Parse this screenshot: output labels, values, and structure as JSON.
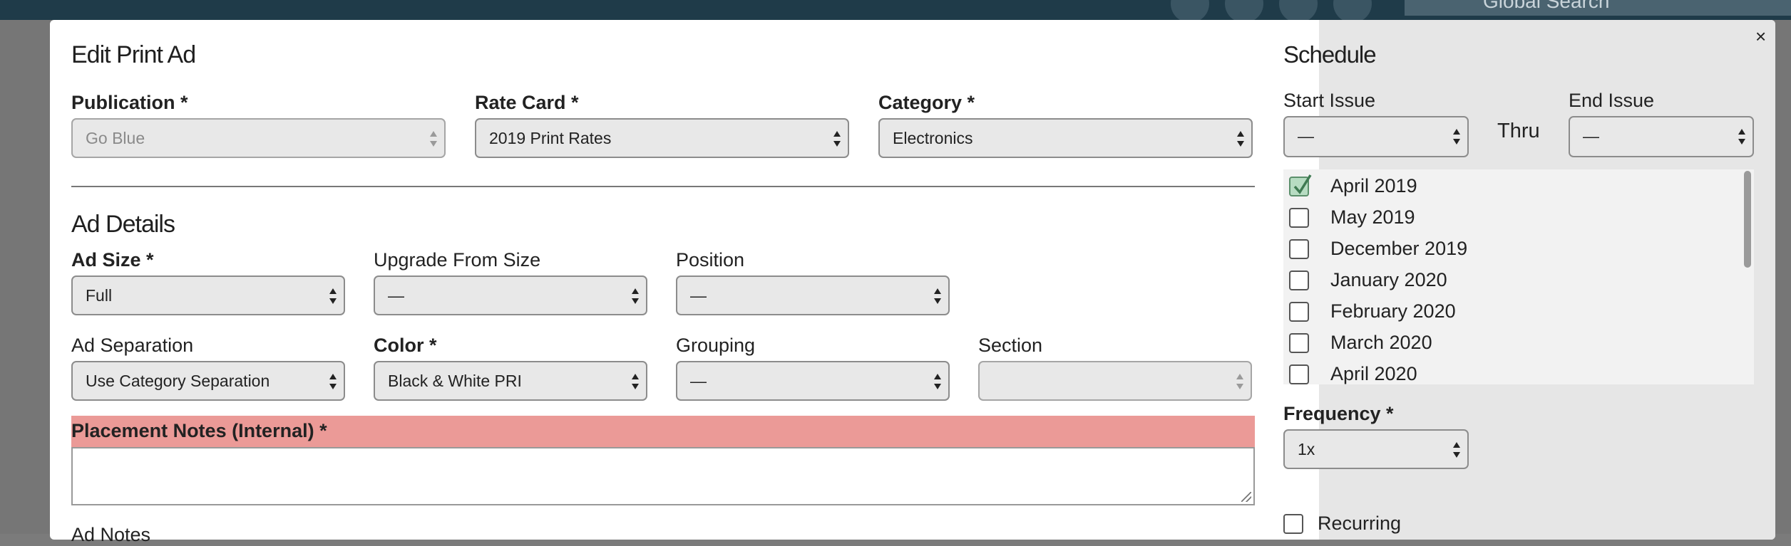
{
  "topbar": {
    "search_placeholder": "Global Search"
  },
  "modal": {
    "title": "Edit Print Ad",
    "close_label": "×",
    "publication": {
      "label": "Publication *",
      "value": "Go Blue"
    },
    "rate_card": {
      "label": "Rate Card *",
      "value": "2019 Print Rates"
    },
    "category": {
      "label": "Category *",
      "value": "Electronics"
    },
    "ad_details": {
      "heading": "Ad Details",
      "ad_size": {
        "label": "Ad Size *",
        "value": "Full"
      },
      "upgrade_from_size": {
        "label": "Upgrade From Size",
        "value": "—"
      },
      "position": {
        "label": "Position",
        "value": "—"
      },
      "ad_separation": {
        "label": "Ad Separation",
        "value": "Use Category Separation"
      },
      "color": {
        "label": "Color *",
        "value": "Black & White PRI"
      },
      "grouping": {
        "label": "Grouping",
        "value": "—"
      },
      "section": {
        "label": "Section",
        "value": ""
      }
    },
    "placement_notes": {
      "label": "Placement Notes (Internal) *",
      "value": ""
    },
    "ad_notes": {
      "label": "Ad Notes"
    }
  },
  "schedule": {
    "heading": "Schedule",
    "start_issue": {
      "label": "Start Issue",
      "value": "—"
    },
    "thru_label": "Thru",
    "end_issue": {
      "label": "End Issue",
      "value": "—"
    },
    "issues": [
      {
        "label": "April 2019",
        "checked": true
      },
      {
        "label": "May 2019",
        "checked": false
      },
      {
        "label": "December 2019",
        "checked": false
      },
      {
        "label": "January 2020",
        "checked": false
      },
      {
        "label": "February 2020",
        "checked": false
      },
      {
        "label": "March 2020",
        "checked": false
      },
      {
        "label": "April 2020",
        "checked": false
      }
    ],
    "frequency": {
      "label": "Frequency *",
      "value": "1x"
    },
    "recurring": {
      "label": "Recurring",
      "checked": false
    }
  },
  "colors": {
    "required_highlight": "#eb9a97",
    "checked_fill": "#b7dcc2",
    "topbar_bg": "#1f3b49"
  }
}
